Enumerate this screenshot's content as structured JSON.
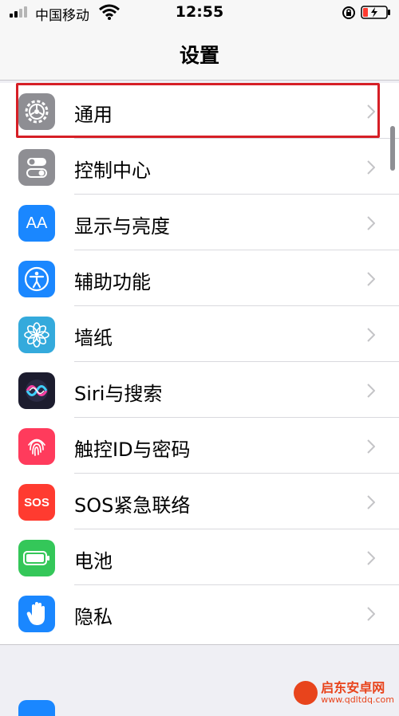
{
  "status_bar": {
    "carrier": "中国移动",
    "time": "12:55"
  },
  "nav": {
    "title": "设置"
  },
  "settings": {
    "items": [
      {
        "label": "通用",
        "icon": "gear-icon",
        "color": "#8e8e93"
      },
      {
        "label": "控制中心",
        "icon": "toggle-icon",
        "color": "#8e8e93"
      },
      {
        "label": "显示与亮度",
        "icon": "text-size-icon",
        "color": "#1a87ff"
      },
      {
        "label": "辅助功能",
        "icon": "accessibility-icon",
        "color": "#1a87ff"
      },
      {
        "label": "墙纸",
        "icon": "flower-icon",
        "color": "#34aadc"
      },
      {
        "label": "Siri与搜索",
        "icon": "siri-icon",
        "color": "#1c1c2e"
      },
      {
        "label": "触控ID与密码",
        "icon": "fingerprint-icon",
        "color": "#ff3b5c"
      },
      {
        "label": "SOS紧急联络",
        "icon": "sos-icon",
        "color": "#ff3b30"
      },
      {
        "label": "电池",
        "icon": "battery-icon",
        "color": "#34c759"
      },
      {
        "label": "隐私",
        "icon": "hand-icon",
        "color": "#1a87ff"
      }
    ],
    "aa_glyph": "AA",
    "sos_glyph": "SOS"
  },
  "watermark": {
    "name": "启东安卓网",
    "url": "www.qdltdq.com"
  },
  "colors": {
    "highlight": "#d61f26",
    "background": "#efeff4"
  }
}
